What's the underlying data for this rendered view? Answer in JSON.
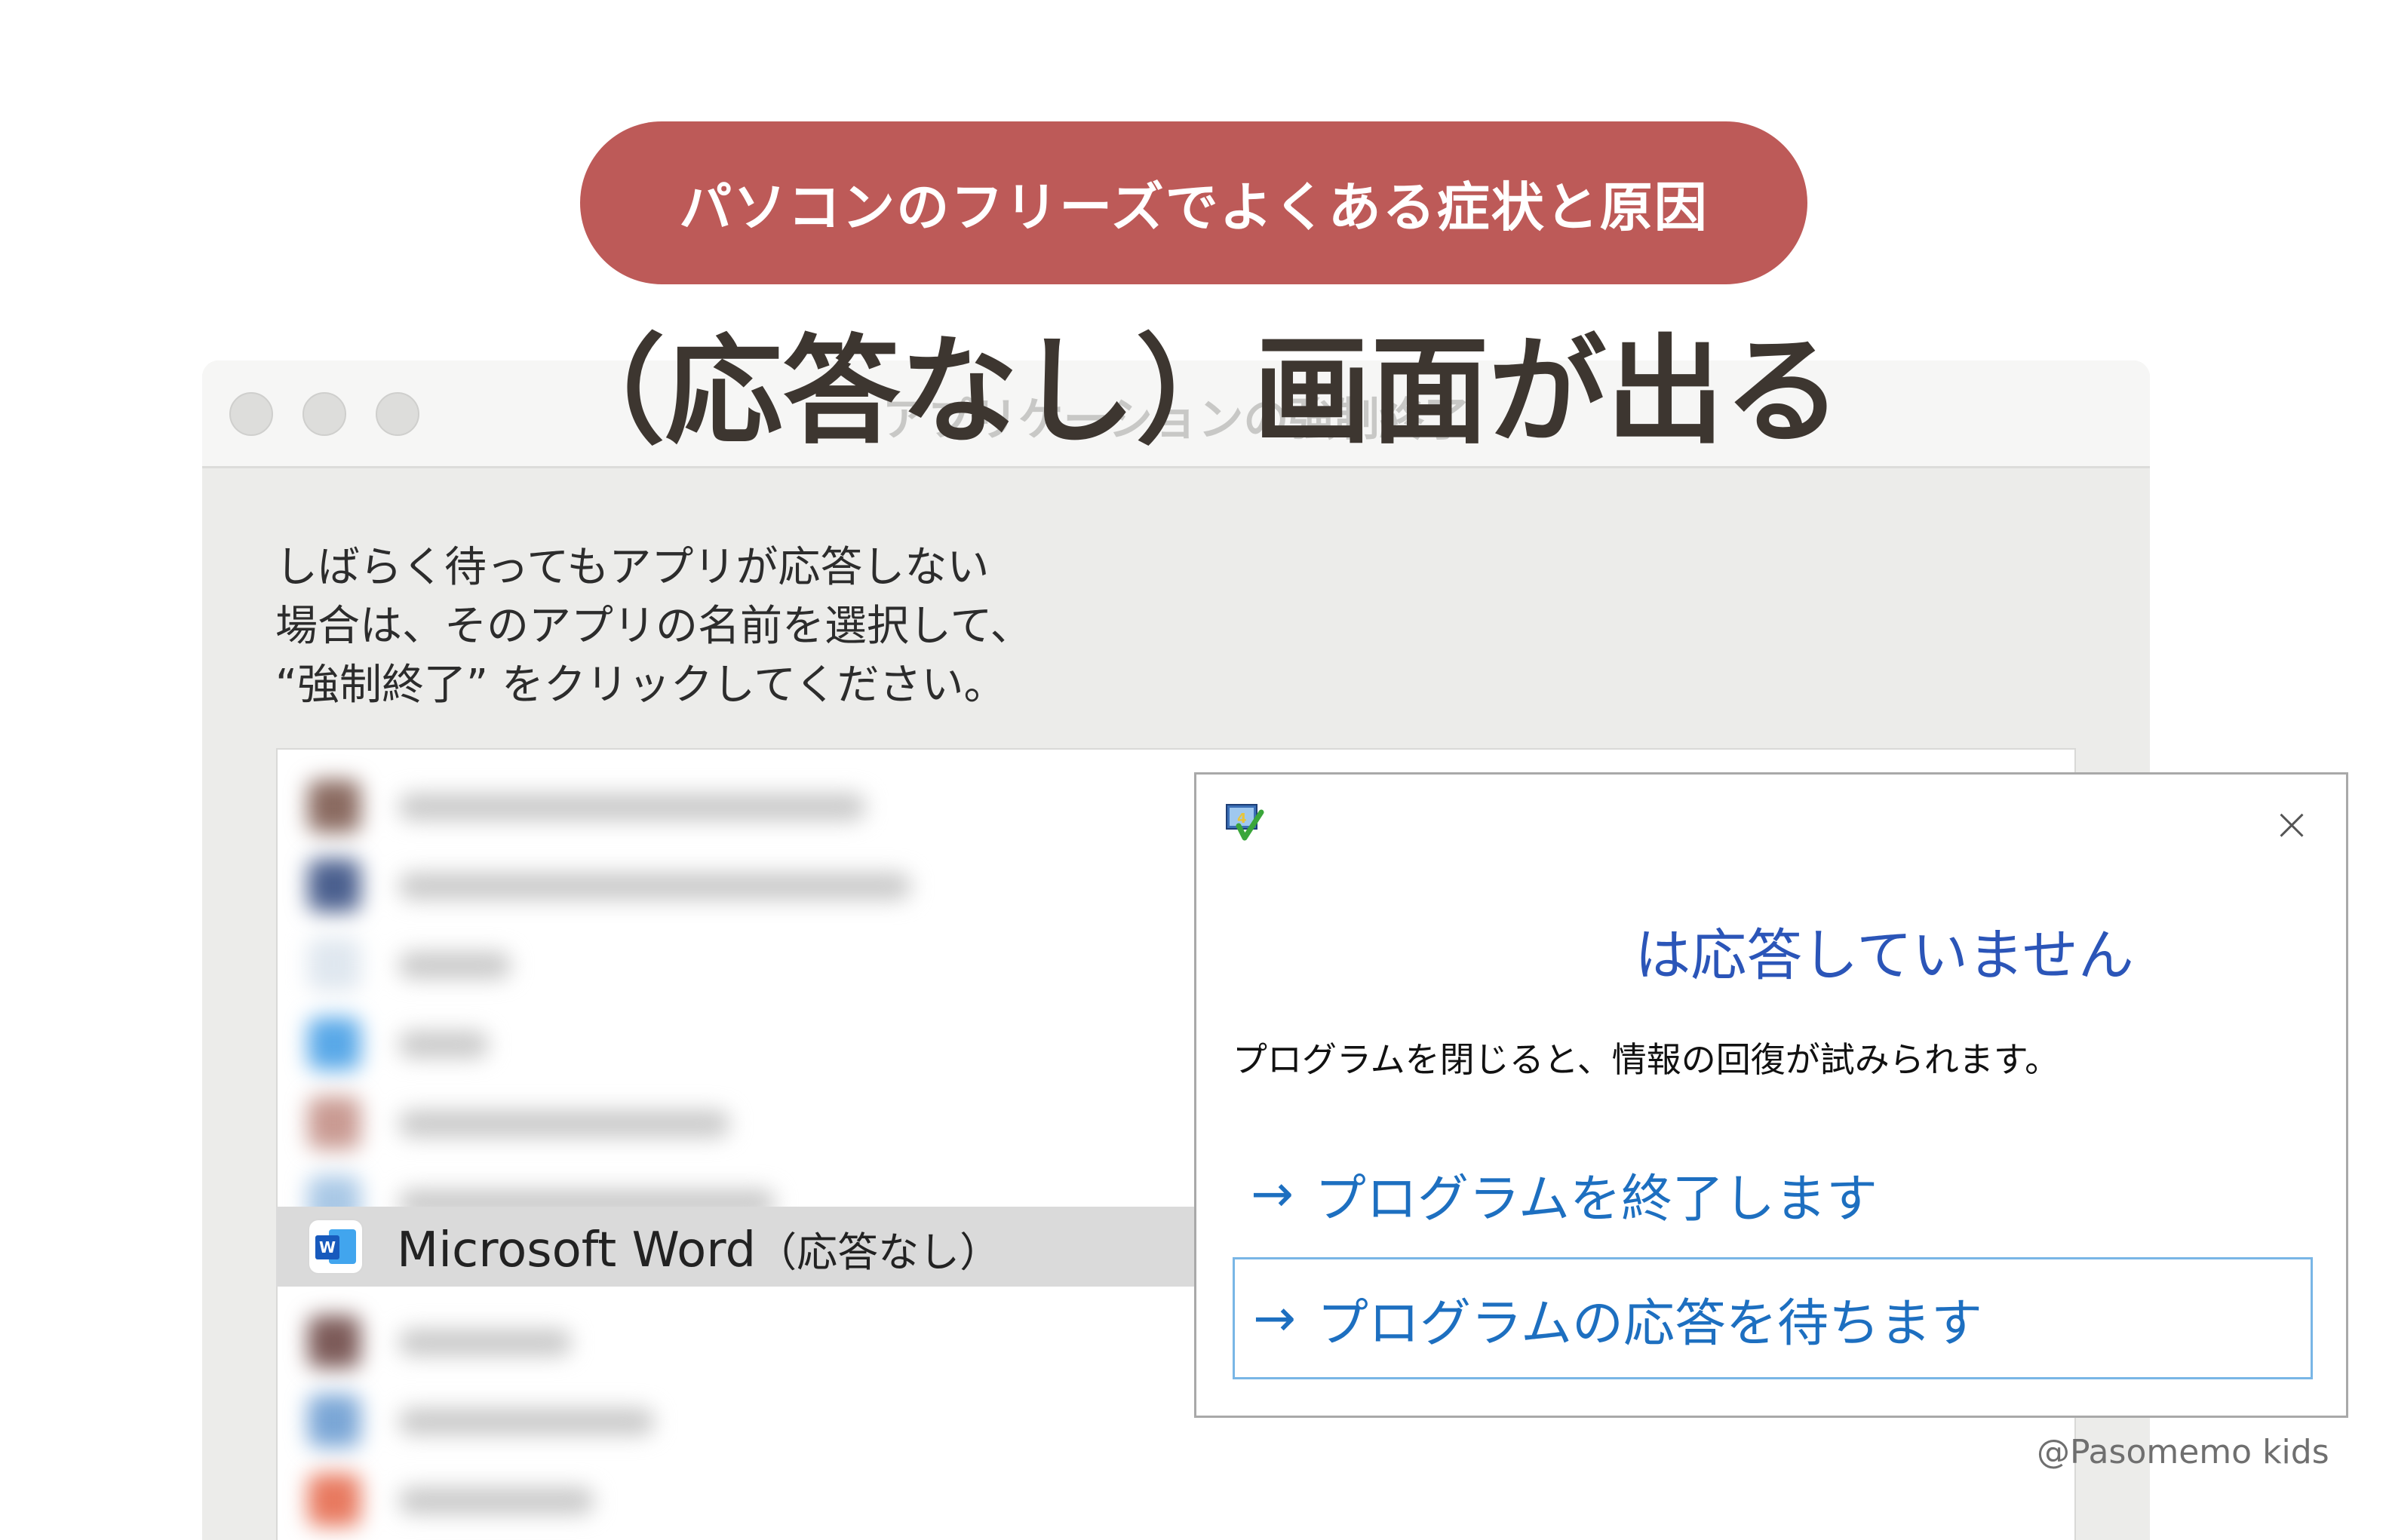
{
  "banner": {
    "text": "パソコンのフリーズでよくある症状と原因"
  },
  "heading": {
    "text": "（応答なし）画面が出る"
  },
  "mac_window": {
    "title": "アプリケーションの強制終了",
    "instructions": [
      "しばらく待ってもアプリが応答しない",
      "場合は、そのアプリの名前を選択して、",
      "“強制終了” をクリックしてください。"
    ],
    "selected_app": {
      "name": "Microsoft Word",
      "status": "（応答なし）",
      "icon": "microsoft-word-icon"
    }
  },
  "win_dialog": {
    "title": "は応答していません",
    "message": "プログラムを閉じると、情報の回復が試みられます。",
    "options": [
      {
        "arrow": "→",
        "label": "プログラムを終了します"
      },
      {
        "arrow": "→",
        "label": "プログラムの応答を待ちます"
      }
    ],
    "close_glyph": "×"
  },
  "watermark": {
    "text": "@Pasomemo kids"
  },
  "colors": {
    "banner": "#bd5a58",
    "heading": "#3d3630",
    "link_blue": "#1d6fc0",
    "title_blue": "#2b55b8",
    "focus_border": "#79b6e6"
  }
}
